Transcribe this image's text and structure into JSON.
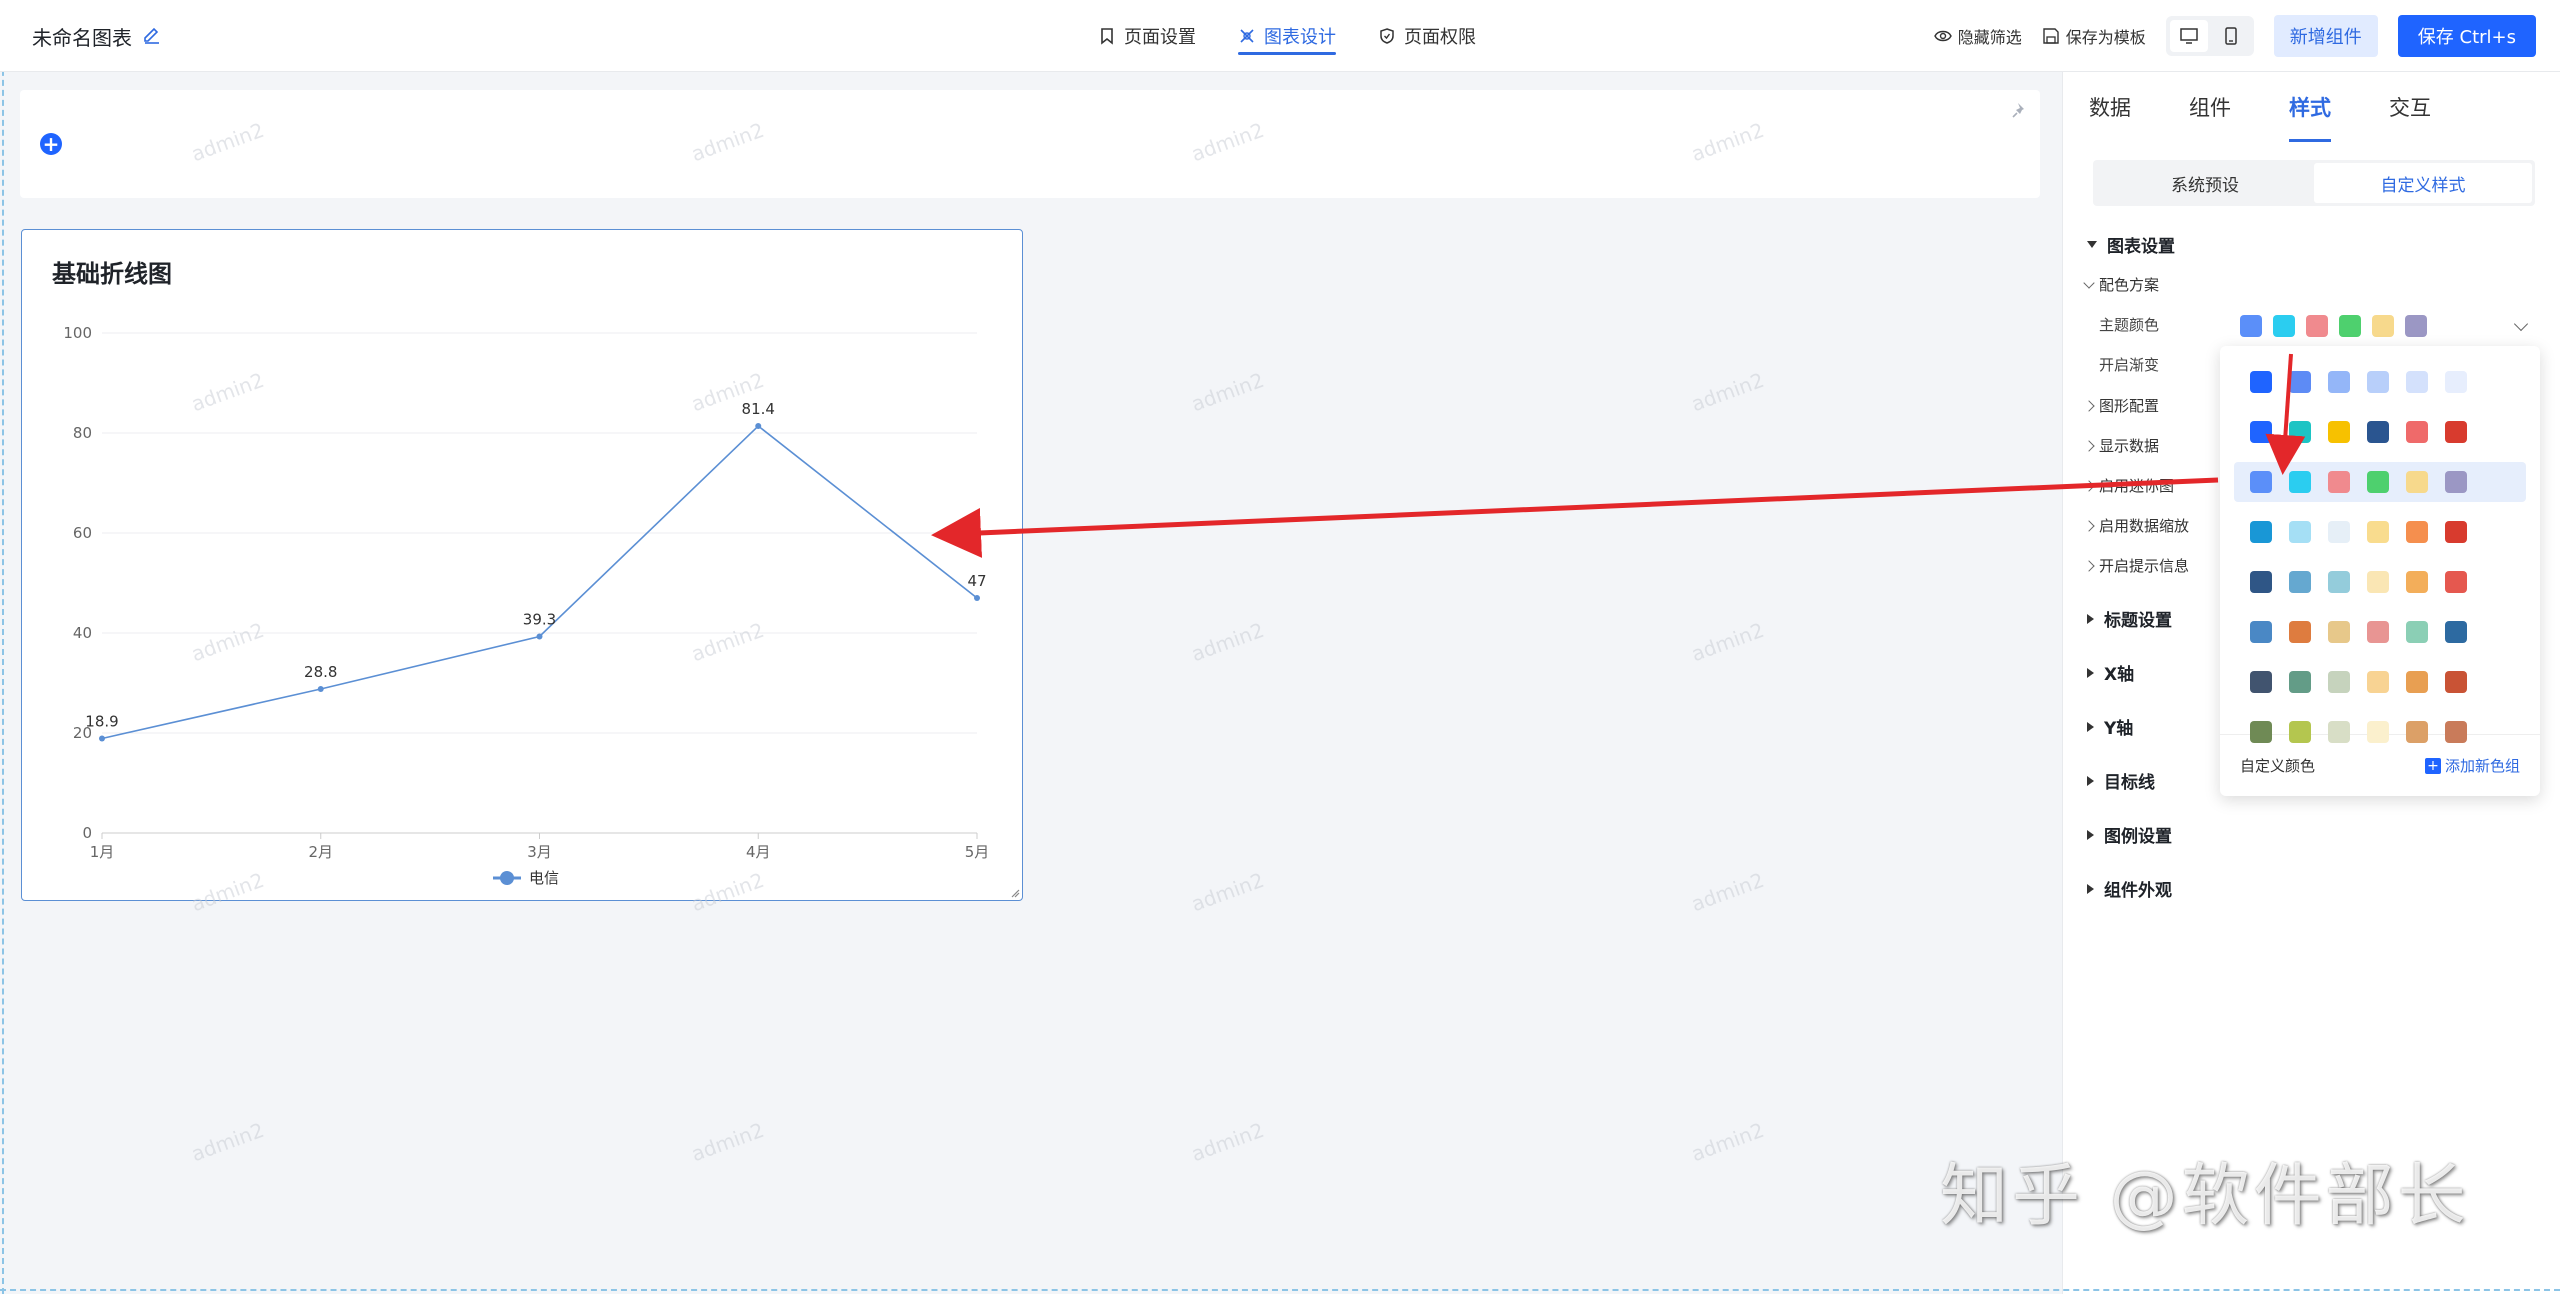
{
  "header": {
    "doc_title": "未命名图表",
    "tabs": [
      {
        "label": "页面设置",
        "icon": "bookmark-icon"
      },
      {
        "label": "图表设计",
        "icon": "design-icon",
        "active": true
      },
      {
        "label": "页面权限",
        "icon": "shield-icon"
      }
    ],
    "hide_filter": "隐藏筛选",
    "save_template": "保存为模板",
    "add_component": "新增组件",
    "save": "保存 Ctrl+s"
  },
  "chart_data": {
    "type": "line",
    "title": "基础折线图",
    "categories": [
      "1月",
      "2月",
      "3月",
      "4月",
      "5月"
    ],
    "series": [
      {
        "name": "电信",
        "values": [
          18.9,
          28.8,
          39.3,
          81.4,
          47
        ]
      }
    ],
    "yticks": [
      "0",
      "20",
      "40",
      "60",
      "80",
      "100"
    ],
    "ylim": [
      0,
      100
    ],
    "legend": "bottom-center",
    "grid": true,
    "color": "#5b8fd4"
  },
  "watermark": "admin2",
  "panel": {
    "tabs": [
      "数据",
      "组件",
      "样式",
      "交互"
    ],
    "active_tab": "样式",
    "segments": [
      "系统预设",
      "自定义样式"
    ],
    "chart_settings": "图表设置",
    "color_scheme": "配色方案",
    "theme_color": "主题颜色",
    "gradient": "开启渐变",
    "sub_items": [
      "图形配置",
      "显示数据",
      "启用迷你图",
      "启用数据缩放",
      "开启提示信息"
    ],
    "sections": [
      "标题设置",
      "X轴",
      "Y轴",
      "目标线",
      "图例设置",
      "组件外观"
    ],
    "selected_theme": [
      "#5b8ff9",
      "#2bcdf0",
      "#f08a8e",
      "#4ed06e",
      "#f7d98c",
      "#9b97c4"
    ],
    "palettes": [
      [
        "#1f64ff",
        "#5d8bf5",
        "#94b6f8",
        "#b8cffa",
        "#d4e1fc",
        "#e7eefd"
      ],
      [
        "#1f64ff",
        "#1dc4c4",
        "#f7c100",
        "#2a5590",
        "#ef6a6a",
        "#d83b2e"
      ],
      [
        "#5b8ff9",
        "#2bcdf0",
        "#f08a8e",
        "#4ed06e",
        "#f7d98c",
        "#9b97c4"
      ],
      [
        "#1997d6",
        "#a5dff5",
        "#e6eff7",
        "#f9dc8e",
        "#f58f4e",
        "#d83b2e"
      ],
      [
        "#2f5686",
        "#65a8d0",
        "#94ccdb",
        "#fae6b4",
        "#f3ae5a",
        "#e5584f"
      ],
      [
        "#4a88c5",
        "#de7c3f",
        "#e7c88a",
        "#e89593",
        "#8bcfb5",
        "#2d6aa1"
      ],
      [
        "#41546f",
        "#639c87",
        "#c6d3bd",
        "#f8d393",
        "#e89f52",
        "#c95335"
      ],
      [
        "#6f8a55",
        "#b4c64f",
        "#d8dec6",
        "#fbf0cd",
        "#dca067",
        "#c97b5a"
      ]
    ],
    "custom_color": "自定义颜色",
    "add_color_set": "添加新色组"
  },
  "footer_watermark": "知乎 @软件部长"
}
